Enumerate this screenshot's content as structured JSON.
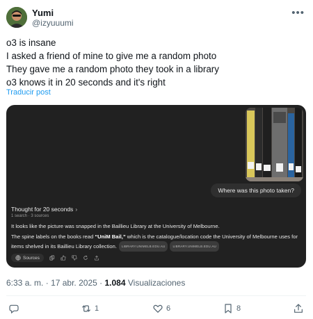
{
  "user": {
    "name": "Yumi",
    "handle": "@izyuuumi"
  },
  "more_label": "•••",
  "tweet_lines": [
    "o3 is insane",
    "I asked a friend of mine to give me a random photo",
    "They gave me a random photo they took in a library",
    "o3 knows it in 20 seconds and it's right"
  ],
  "translate_label": "Traducir post",
  "media": {
    "question": "Where was this photo taken?",
    "thought": "Thought for 20 seconds",
    "thought_chevron": "›",
    "sources_meta": "1 search · 3 sources",
    "answer_p1": "It looks like the picture was snapped in the Baillieu Library at the University of Melbourne.",
    "answer_p2_a": "The spine labels on the books read ",
    "answer_p2_bold": "“UniM Bail,”",
    "answer_p2_b": " which is the catalogue/location code the University of Melbourne uses for items shelved in its Baillieu Library collection.",
    "chip1": "LIBRARY.UNIMELB.EDU.AU",
    "chip2": "LIBRARY.UNIMELB.EDU.AU",
    "sources_button": "Sources"
  },
  "meta": {
    "time": "6:33 a. m.",
    "sep": "·",
    "date": "17 abr. 2025",
    "sep2": "·",
    "views": "1.084",
    "views_label": "Visualizaciones"
  },
  "actions": {
    "replies": "",
    "reposts": "1",
    "likes": "6",
    "bookmarks": "8"
  },
  "colors": {
    "link": "#1d9bf0",
    "muted": "#536471",
    "card_bg": "#212121"
  }
}
